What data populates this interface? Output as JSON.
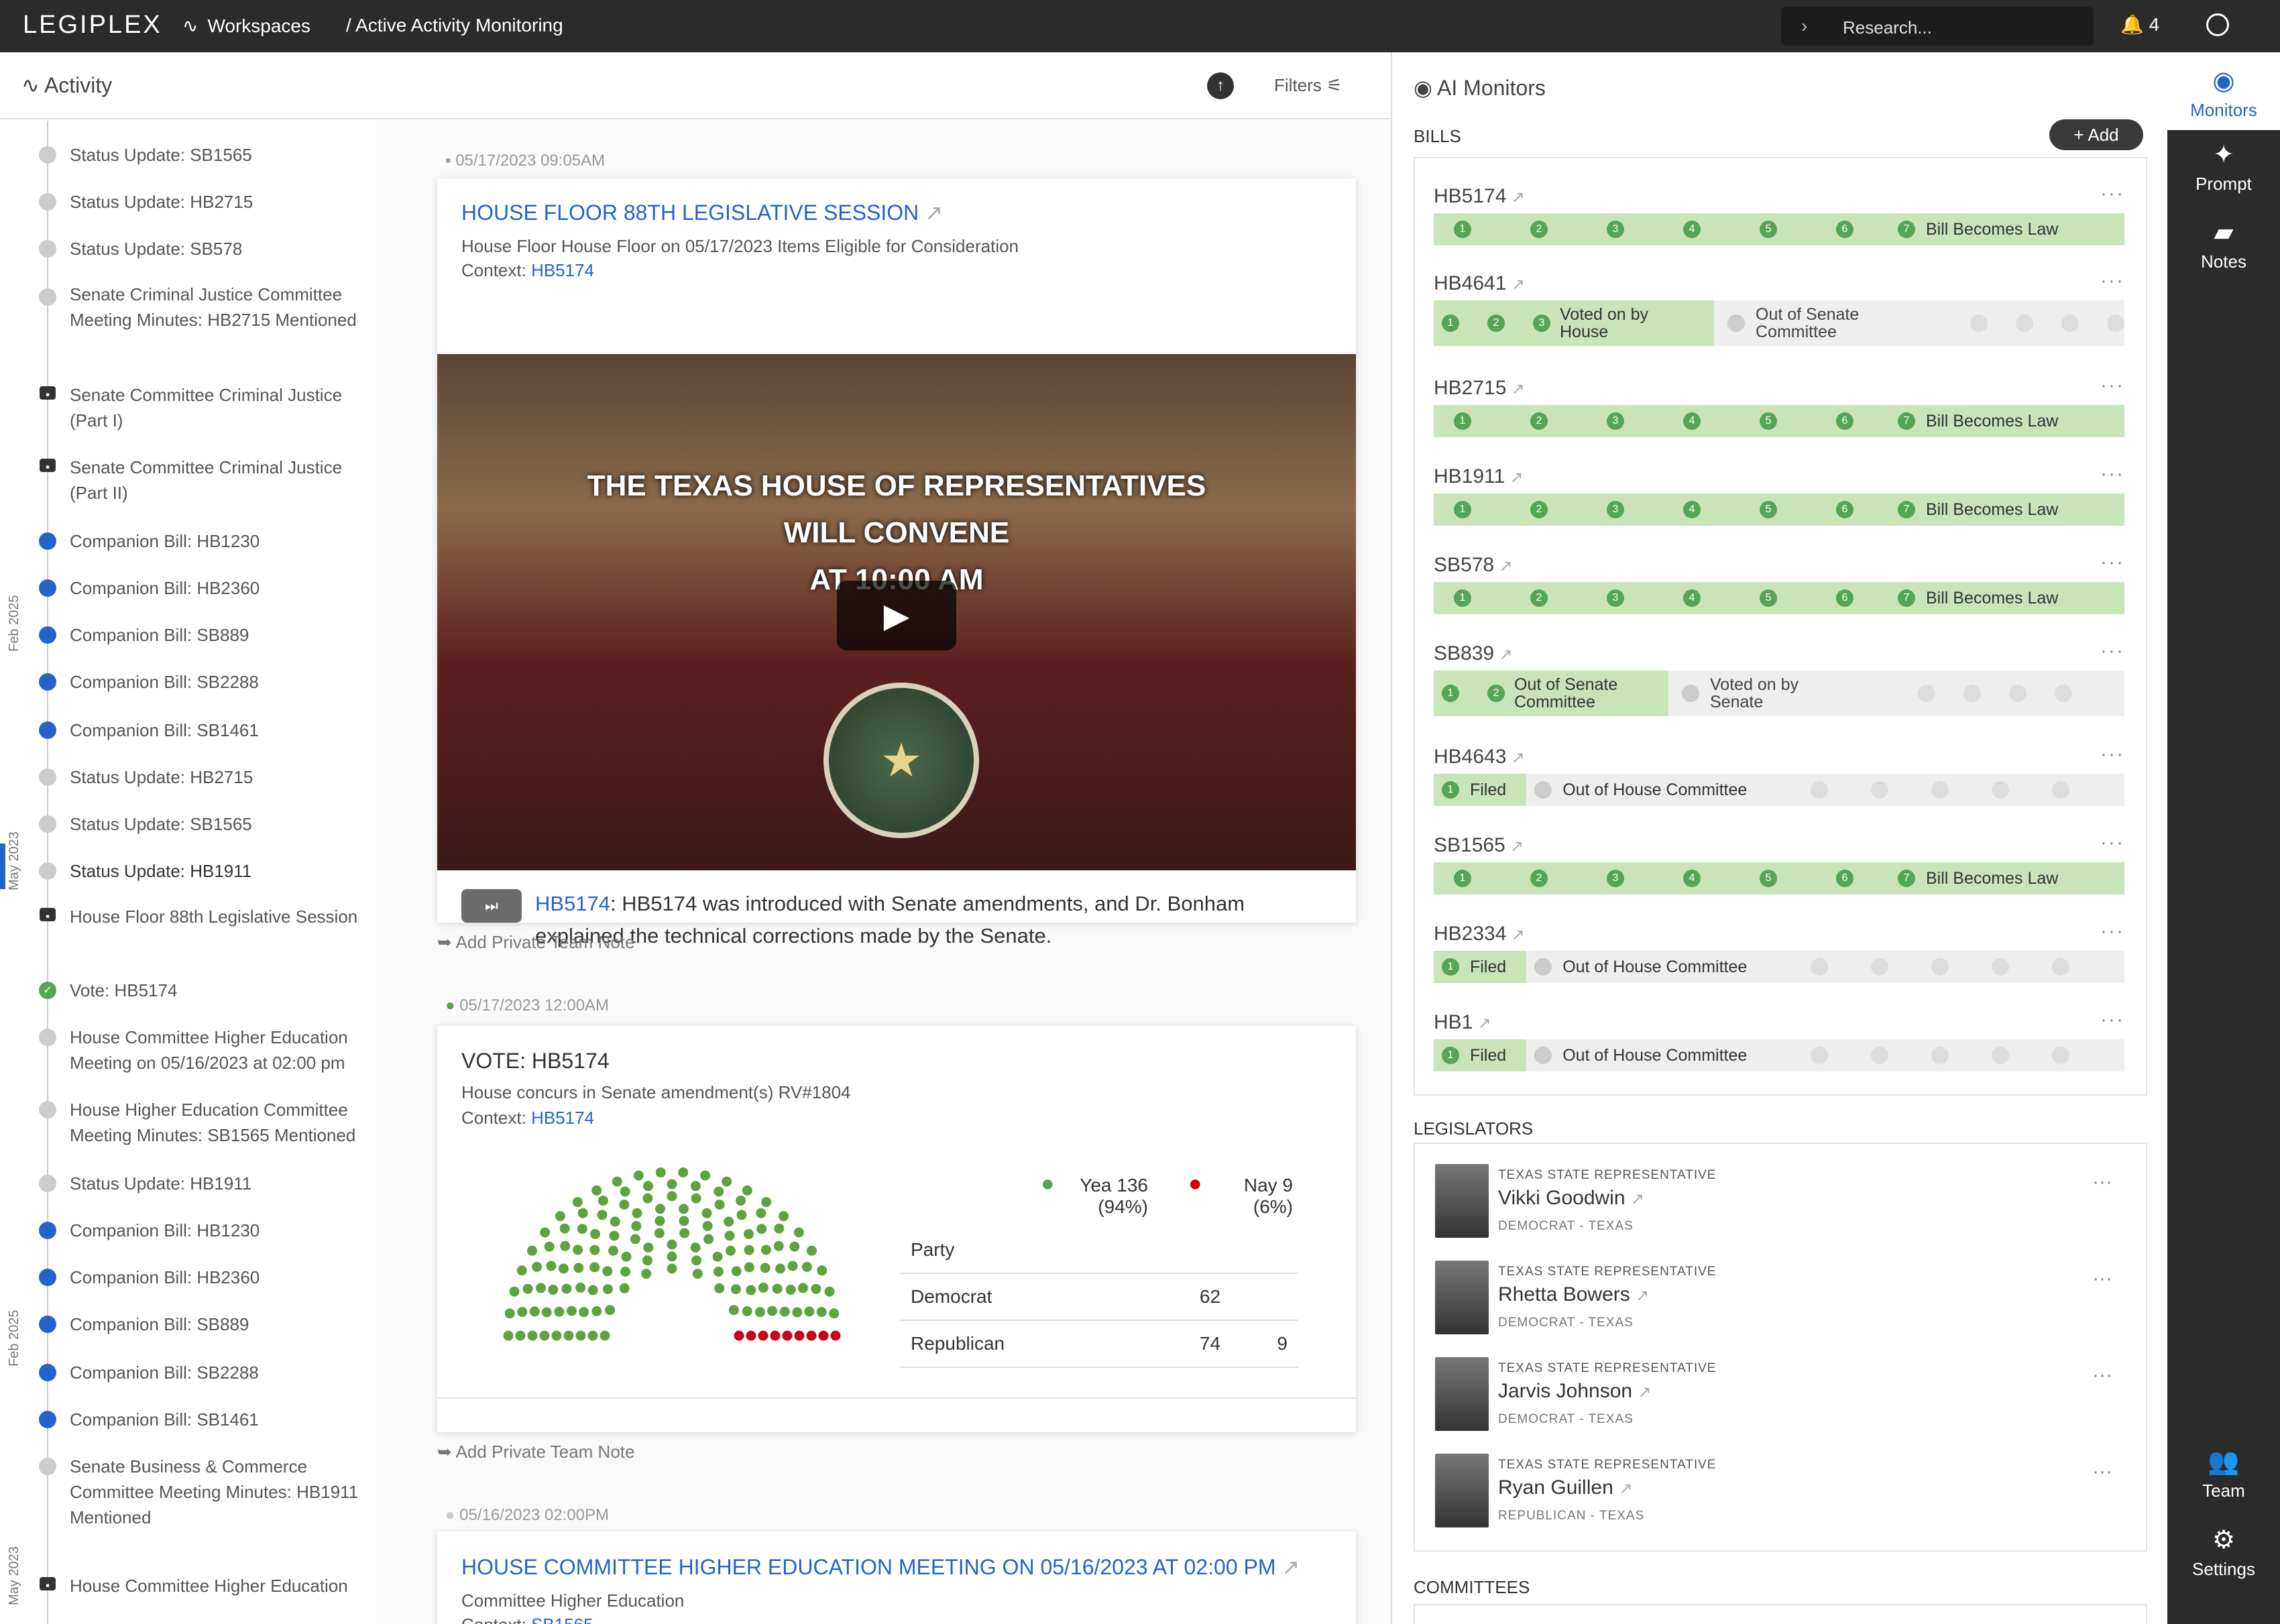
{
  "topbar": {
    "logo": "LEGIPLEX",
    "workspaces": "Workspaces",
    "breadcrumb": "/  Active Activity Monitoring",
    "search_placeholder": "Research...",
    "notifications": "4"
  },
  "activity": {
    "title": "Activity",
    "filters": "Filters"
  },
  "timeline": [
    {
      "label": "Status Update: SB1565",
      "icon": "grey"
    },
    {
      "label": "Status Update: HB2715",
      "icon": "grey"
    },
    {
      "label": "Status Update: SB578",
      "icon": "grey"
    },
    {
      "label": "Senate Criminal Justice Committee Meeting Minutes: HB2715 Mentioned",
      "icon": "grey"
    },
    {
      "label": "Senate Committee Criminal Justice (Part I)",
      "icon": "video"
    },
    {
      "label": "Senate Committee Criminal Justice (Part II)",
      "icon": "video"
    },
    {
      "label": "Companion Bill: HB1230",
      "icon": "blue"
    },
    {
      "label": "Companion Bill: HB2360",
      "icon": "blue"
    },
    {
      "label": "Companion Bill: SB889",
      "icon": "blue"
    },
    {
      "label": "Companion Bill: SB2288",
      "icon": "blue"
    },
    {
      "label": "Companion Bill: SB1461",
      "icon": "blue"
    },
    {
      "label": "Status Update: HB2715",
      "icon": "grey"
    },
    {
      "label": "Status Update: SB1565",
      "icon": "grey"
    },
    {
      "label": "Status Update: HB1911",
      "icon": "grey"
    },
    {
      "label": "House Floor 88th Legislative Session",
      "icon": "video"
    },
    {
      "label": "Vote: HB5174",
      "icon": "green"
    },
    {
      "label": "House Committee Higher Education Meeting on 05/16/2023 at 02:00 pm",
      "icon": "grey"
    },
    {
      "label": "House Higher Education Committee Meeting Minutes: SB1565 Mentioned",
      "icon": "grey"
    },
    {
      "label": "Status Update: HB1911",
      "icon": "grey"
    },
    {
      "label": "Companion Bill: HB1230",
      "icon": "blue"
    },
    {
      "label": "Companion Bill: HB2360",
      "icon": "blue"
    },
    {
      "label": "Companion Bill: SB889",
      "icon": "blue"
    },
    {
      "label": "Companion Bill: SB2288",
      "icon": "blue"
    },
    {
      "label": "Companion Bill: SB1461",
      "icon": "blue"
    },
    {
      "label": "Senate Business & Commerce Committee Meeting Minutes: HB1911 Mentioned",
      "icon": "grey"
    },
    {
      "label": "House Committee Higher Education",
      "icon": "video"
    }
  ],
  "month_labels": [
    "Feb 2025",
    "May 2023",
    "Feb 2025",
    "May 2023"
  ],
  "feed": {
    "card1": {
      "timestamp": "05/17/2023 09:05AM",
      "title": "HOUSE FLOOR 88TH LEGISLATIVE SESSION",
      "subtitle": "House Floor House Floor on 05/17/2023 Items Eligible for Consideration",
      "context_label": "Context: ",
      "context_link": "HB5174",
      "video_line1": "THE TEXAS HOUSE OF REPRESENTATIVES",
      "video_line2": "WILL CONVENE",
      "video_line3": "AT 10:00 AM",
      "summary_link": "HB5174",
      "summary_text": ": HB5174 was introduced with Senate amendments, and Dr. Bonham explained the technical corrections made by the Senate."
    },
    "note_label": "Add Private Team Note",
    "card2": {
      "timestamp": "05/17/2023 12:00AM",
      "title": "VOTE: HB5174",
      "subtitle": "House concurs in Senate amendment(s) RV#1804",
      "context_label": "Context: ",
      "context_link": "HB5174",
      "yea_label": "Yea 136",
      "yea_pct": "(94%)",
      "nay_label": "Nay 9",
      "nay_pct": "(6%)",
      "party_header": "Party",
      "rows": [
        {
          "party": "Democrat",
          "yea": "62",
          "nay": ""
        },
        {
          "party": "Republican",
          "yea": "74",
          "nay": "9"
        }
      ],
      "yea": 136,
      "nay": 9
    },
    "card3": {
      "timestamp": "05/16/2023 02:00PM",
      "title": "HOUSE COMMITTEE HIGHER EDUCATION MEETING ON 05/16/2023 AT 02:00 PM",
      "subtitle": "Committee Higher Education",
      "context_label": "Context: ",
      "context_link": "SB1565"
    }
  },
  "monitors": {
    "title": "AI Monitors",
    "bills_label": "BILLS",
    "add_label": "+ Add",
    "legislators_label": "LEGISLATORS",
    "committees_label": "COMMITTEES",
    "bills": [
      {
        "name": "HB5174",
        "type": "full",
        "final": "Bill Becomes Law"
      },
      {
        "name": "HB4641",
        "type": "partial",
        "done": 3,
        "current": "Voted on by House",
        "next": "Out of Senate Committee"
      },
      {
        "name": "HB2715",
        "type": "full",
        "final": "Bill Becomes Law"
      },
      {
        "name": "HB1911",
        "type": "full",
        "final": "Bill Becomes Law"
      },
      {
        "name": "SB578",
        "type": "full",
        "final": "Bill Becomes Law"
      },
      {
        "name": "SB839",
        "type": "partial",
        "done": 2,
        "current": "Out of Senate Committee",
        "next": "Voted on by Senate"
      },
      {
        "name": "HB4643",
        "type": "filed",
        "current": "Filed",
        "next": "Out of House Committee"
      },
      {
        "name": "SB1565",
        "type": "full",
        "final": "Bill Becomes Law"
      },
      {
        "name": "HB2334",
        "type": "filed",
        "current": "Filed",
        "next": "Out of House Committee"
      },
      {
        "name": "HB1",
        "type": "filed",
        "current": "Filed",
        "next": "Out of House Committee"
      }
    ],
    "legislators": [
      {
        "title": "TEXAS STATE REPRESENTATIVE",
        "name": "Vikki Goodwin",
        "party": "DEMOCRAT - TEXAS"
      },
      {
        "title": "TEXAS STATE REPRESENTATIVE",
        "name": "Rhetta Bowers",
        "party": "DEMOCRAT - TEXAS"
      },
      {
        "title": "TEXAS STATE REPRESENTATIVE",
        "name": "Jarvis Johnson",
        "party": "DEMOCRAT - TEXAS"
      },
      {
        "title": "TEXAS STATE REPRESENTATIVE",
        "name": "Ryan Guillen",
        "party": "REPUBLICAN - TEXAS"
      }
    ]
  },
  "sidebar": {
    "monitors": "Monitors",
    "prompt": "Prompt",
    "notes": "Notes",
    "team": "Team",
    "settings": "Settings"
  }
}
